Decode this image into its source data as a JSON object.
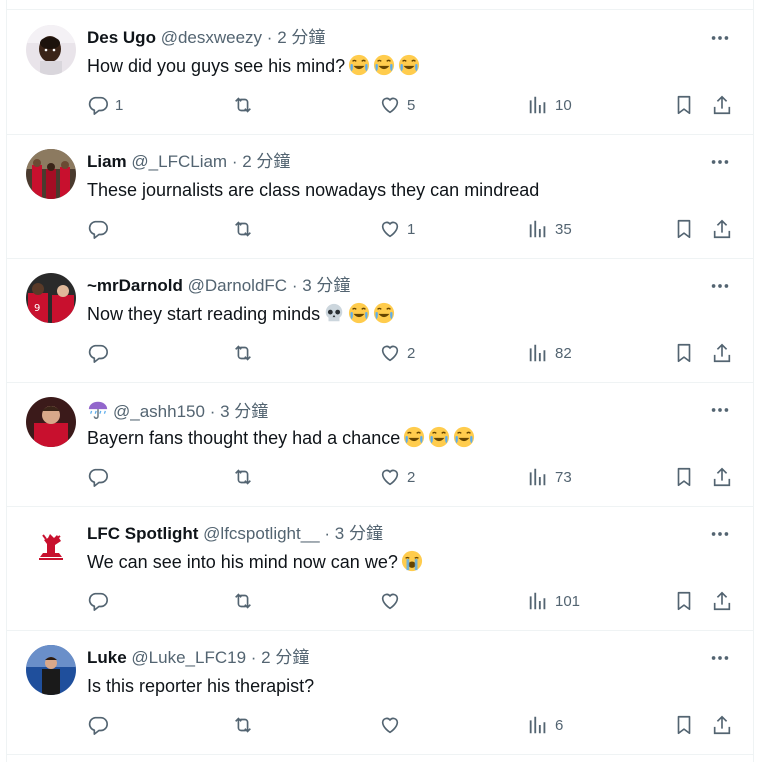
{
  "tweets": [
    {
      "name": "Des Ugo",
      "handle": "@desxweezy",
      "time": "2 分鐘",
      "text": "How did you guys see his mind?",
      "emoji": [
        "joy",
        "joy",
        "joy"
      ],
      "replies": "1",
      "retweets": "",
      "likes": "5",
      "views": "10",
      "avatar": "kid"
    },
    {
      "name": "Liam",
      "handle": "@_LFCLiam",
      "time": "2 分鐘",
      "text": "These journalists are class nowadays they can mindread",
      "emoji": [],
      "replies": "",
      "retweets": "",
      "likes": "1",
      "views": "35",
      "avatar": "stadium"
    },
    {
      "name": "~mrDarnold",
      "handle": "@DarnoldFC",
      "time": "3 分鐘",
      "text": "Now they start reading minds",
      "emoji": [
        "skull",
        "joy",
        "joy"
      ],
      "replies": "",
      "retweets": "",
      "likes": "2",
      "views": "82",
      "avatar": "players"
    },
    {
      "name": "",
      "handle": "@_ashh150",
      "time": "3 分鐘",
      "text": "Bayern fans thought they had a chance",
      "emoji": [
        "joy",
        "joy",
        "joy"
      ],
      "replies": "",
      "retweets": "",
      "likes": "2",
      "views": "73",
      "avatar": "player-red",
      "name_icon": "umbrella-icon"
    },
    {
      "name": "LFC Spotlight",
      "handle": "@lfcspotlight__",
      "time": "3 分鐘",
      "text": "We can see into his mind now can we?",
      "emoji": [
        "cry"
      ],
      "replies": "",
      "retweets": "",
      "likes": "",
      "views": "101",
      "avatar": "liverbird"
    },
    {
      "name": "Luke",
      "handle": "@Luke_LFC19",
      "time": "2 分鐘",
      "text": "Is this reporter his therapist?",
      "emoji": [],
      "replies": "",
      "retweets": "",
      "likes": "",
      "views": "6",
      "avatar": "player-blue"
    }
  ],
  "separator": "·",
  "colors": {
    "text": "#0f1419",
    "muted": "#536471",
    "border": "#eff3f4",
    "lfc_red": "#c8102e"
  },
  "icons": {
    "reply": "reply-icon",
    "retweet": "retweet-icon",
    "like": "heart-icon",
    "views": "views-icon",
    "bookmark": "bookmark-icon",
    "share": "share-icon",
    "more": "more-icon"
  }
}
